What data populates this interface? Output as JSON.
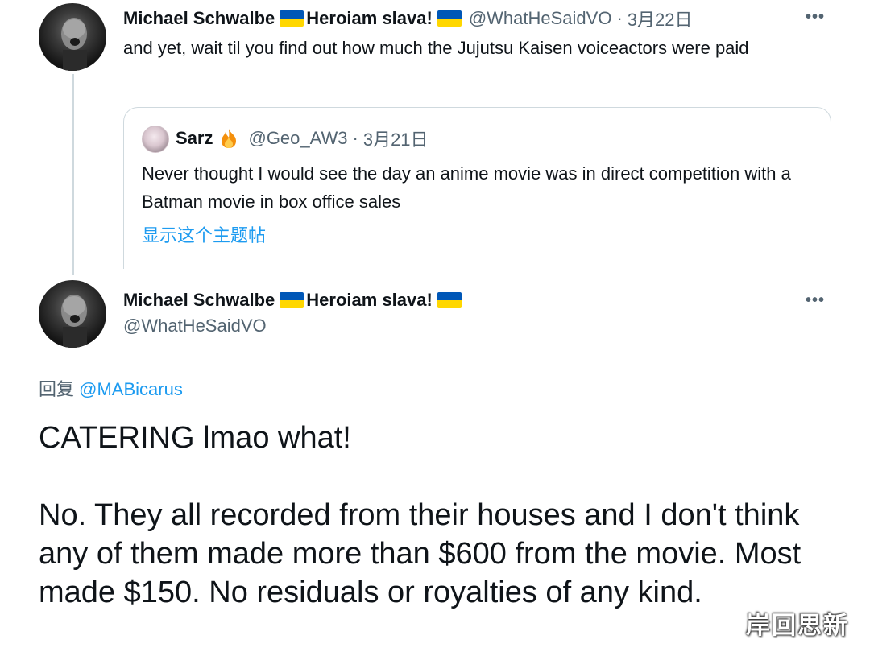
{
  "tweet1": {
    "display_name": "Michael Schwalbe",
    "slogan": "Heroiam slava!",
    "handle": "@WhatHeSaidVO",
    "separator": "·",
    "date": "3月22日",
    "more": "•••",
    "text": "and yet, wait til you find out how much the Jujutsu Kaisen voiceactors were paid",
    "quote": {
      "display_name": "Sarz",
      "emoji": "fire-emoji",
      "handle": "@Geo_AW3",
      "separator": "·",
      "date": "3月21日",
      "text": "Never thought I would see the day an anime movie was in direct competition with a Batman movie in box office sales",
      "show_thread": "显示这个主题帖"
    }
  },
  "tweet2": {
    "display_name": "Michael Schwalbe",
    "slogan": "Heroiam slava!",
    "handle": "@WhatHeSaidVO",
    "more": "•••",
    "reply_prefix": "回复",
    "reply_to": "@MABicarus",
    "line1": "CATERING lmao what!",
    "paragraph": "No. They all recorded from their houses and I don't think any of them made more than $600 from the movie. Most made $150. No residuals or royalties of any kind."
  },
  "watermark": "岸回思新",
  "colors": {
    "text": "#0f1419",
    "secondary": "#536471",
    "link": "#1d9bf0",
    "border": "#cfd9de",
    "flag_blue": "#0057b7",
    "flag_yellow": "#ffd700"
  }
}
